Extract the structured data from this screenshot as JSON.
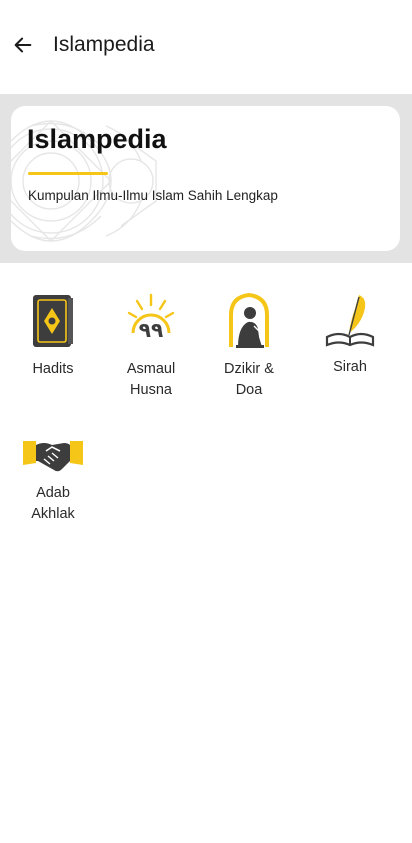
{
  "appbar": {
    "title": "Islampedia",
    "back_icon": "arrow-left-icon"
  },
  "banner": {
    "title": "Islampedia",
    "subtitle": "Kumpulan Ilmu-Ilmu Islam Sahih Lengkap",
    "accent_color": "#F5C518"
  },
  "menu": {
    "items": [
      {
        "label": "Hadits",
        "icon": "quran-book-icon"
      },
      {
        "label": "Asmaul\nHusna",
        "icon": "ninety-nine-names-icon"
      },
      {
        "label": "Dzikir &\nDoa",
        "icon": "praying-man-icon"
      },
      {
        "label": "Sirah",
        "icon": "quill-book-icon"
      },
      {
        "label": "Adab\nAkhlak",
        "icon": "handshake-icon"
      }
    ]
  },
  "colors": {
    "accent": "#F5C518",
    "icon_dark": "#3D3D3D",
    "banner_band": "#E3E3E3"
  }
}
